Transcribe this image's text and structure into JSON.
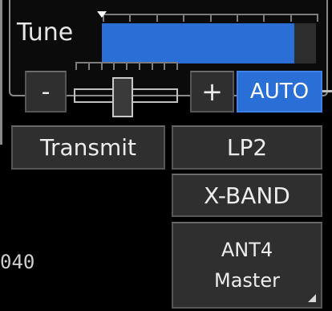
{
  "tune": {
    "label": "Tune",
    "level_fraction": 0.9
  },
  "buttons": {
    "minus": "-",
    "plus": "+",
    "auto": "AUTO",
    "transmit": "Transmit",
    "pulse": "LP2",
    "band": "X-BAND",
    "antenna_line1": "ANT4",
    "antenna_line2": "Master"
  },
  "side_readout": "040",
  "slider": {
    "level_fraction": 0.4
  },
  "colors": {
    "accent_blue": "#2a6fd6",
    "background": "#000000",
    "button_bg": "#2f2f2f"
  }
}
